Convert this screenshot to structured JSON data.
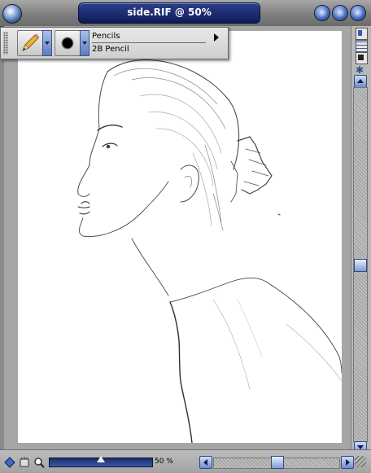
{
  "window": {
    "title": "side.RIF @ 50%",
    "app_icon": "painter-logo-icon",
    "controls": [
      "minimize-icon",
      "maximize-icon",
      "close-icon"
    ]
  },
  "property_bar": {
    "brush_category": "Pencils",
    "brush_variant": "2B Pencil",
    "tool_icon": "pencil-icon",
    "dab_icon": "brush-dab-icon"
  },
  "status_bar": {
    "zoom_text": "50 %",
    "zoom_level": 0.5
  },
  "colors": {
    "title_tab": "#1a2a6e",
    "accent_blue": "#4d72c0",
    "canvas": "#ffffff",
    "frame": "#a6a6a6"
  }
}
